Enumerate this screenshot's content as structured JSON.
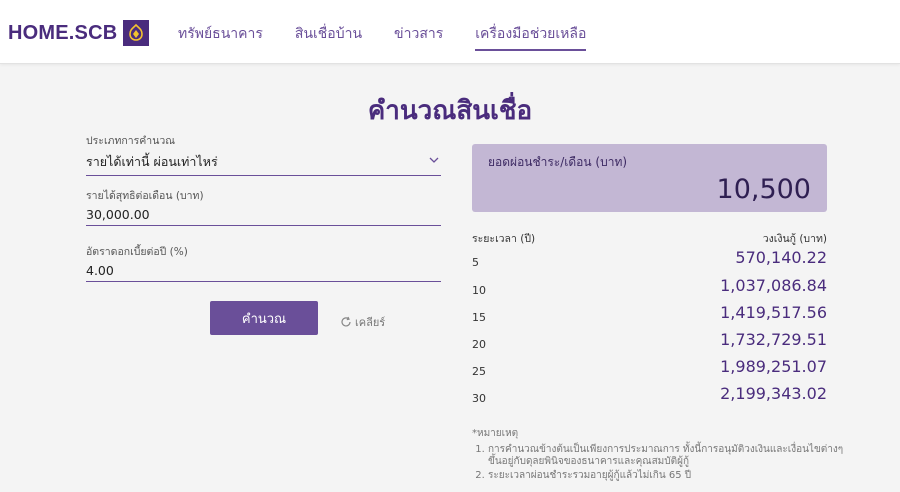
{
  "header": {
    "logo_text": "HOME.SCB",
    "nav": [
      {
        "label": "ทรัพย์ธนาคาร",
        "active": false
      },
      {
        "label": "สินเชื่อบ้าน",
        "active": false
      },
      {
        "label": "ข่าวสาร",
        "active": false
      },
      {
        "label": "เครื่องมือช่วยเหลือ",
        "active": true
      }
    ]
  },
  "page": {
    "title": "คำนวณสินเชื่อ"
  },
  "form": {
    "calc_type": {
      "label": "ประเภทการคำนวณ",
      "value": "รายได้เท่านี้ ผ่อนเท่าไหร่"
    },
    "income": {
      "label": "รายได้สุทธิต่อเดือน (บาท)",
      "value": "30,000.00"
    },
    "rate": {
      "label": "อัตราดอกเบี้ยต่อปี (%)",
      "value": "4.00"
    },
    "calc_label": "คำนวณ",
    "clear_label": "เคลียร์"
  },
  "result": {
    "label": "ยอดผ่อนชำระ/เดือน (บาท)",
    "value": "10,500"
  },
  "table": {
    "col_period": "ระยะเวลา (ปี)",
    "col_amount": "วงเงินกู้ (บาท)",
    "rows": [
      {
        "period": "5",
        "amount": "570,140.22"
      },
      {
        "period": "10",
        "amount": "1,037,086.84"
      },
      {
        "period": "15",
        "amount": "1,419,517.56"
      },
      {
        "period": "20",
        "amount": "1,732,729.51"
      },
      {
        "period": "25",
        "amount": "1,989,251.07"
      },
      {
        "period": "30",
        "amount": "2,199,343.02"
      }
    ]
  },
  "notes": {
    "title": "*หมายเหตุ",
    "items": [
      "การคำนวณข้างต้นเป็นเพียงการประมาณการ ทั้งนี้การอนุมัติวงเงินและเงื่อนไขต่างๆ ขึ้นอยู่กับดุลยพินิจของธนาคารและคุณสมบัติผู้กู้",
      "ระยะเวลาผ่อนชำระรวมอายุผู้กู้แล้วไม่เกิน 65 ปี"
    ]
  },
  "colors": {
    "brand": "#4a2c7d",
    "accent": "#6a4f99",
    "result_bg": "#c3b7d4"
  }
}
